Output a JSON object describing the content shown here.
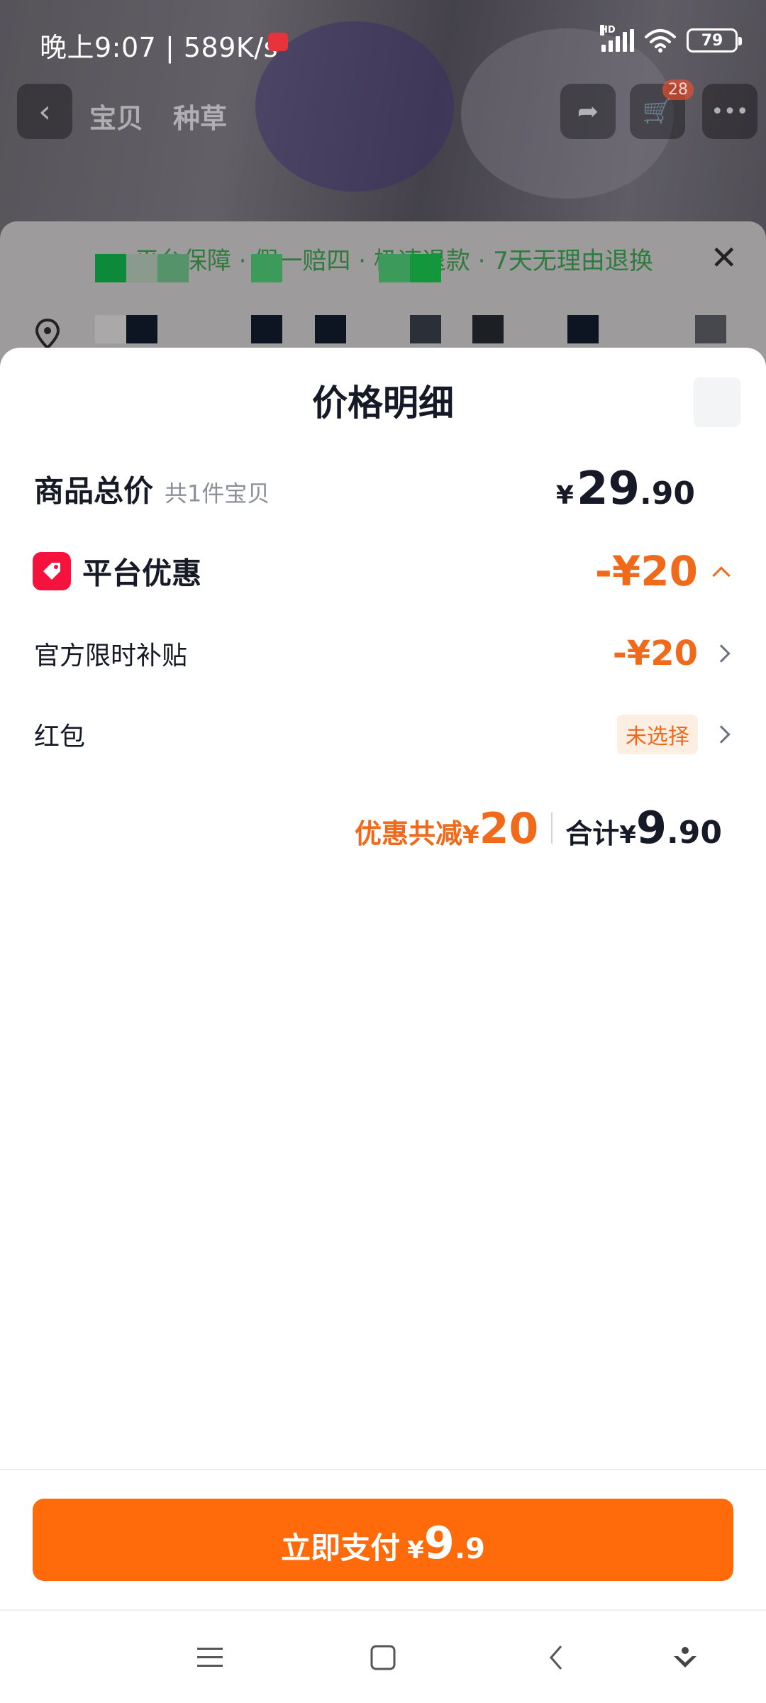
{
  "status_bar": {
    "time": "晚上9:07",
    "separator": "|",
    "speed": "589K/s",
    "battery": "79",
    "signal_label": "HD"
  },
  "background_page": {
    "tabs": [
      "宝贝",
      "种草"
    ],
    "cart_count": "28",
    "guarantee_text": "平台保障 · 假一赔四 · 极速退款 · 7天无理由退换"
  },
  "panel": {
    "title": "价格明细",
    "goods_total": {
      "label": "商品总价",
      "count_text": "共1件宝贝",
      "currency": "¥",
      "price_int": "29",
      "price_dec": ".90"
    },
    "platform_discount": {
      "label": "平台优惠",
      "amount": "-¥20"
    },
    "official_subsidy": {
      "label": "官方限时补贴",
      "amount": "-¥20"
    },
    "red_packet": {
      "label": "红包",
      "status": "未选择"
    },
    "summary": {
      "discount_label": "优惠共减",
      "currency": "¥",
      "discount_amount": "20",
      "total_label": "合计",
      "total_int": "9",
      "total_dec": ".90"
    }
  },
  "pay_button": {
    "label": "立即支付",
    "currency": "¥",
    "amount_int": "9",
    "amount_dec": ".9"
  },
  "colors": {
    "accent": "#ff6a0a",
    "discount_text": "#f06a1b",
    "promo_icon": "#f5123d",
    "text_primary": "#151a26"
  }
}
